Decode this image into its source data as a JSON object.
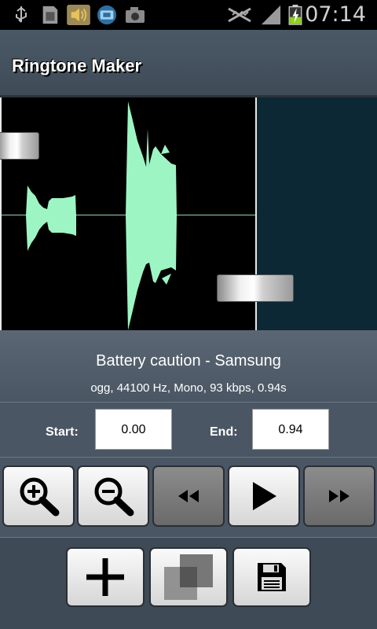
{
  "status_bar": {
    "time": "07:14",
    "icons": [
      "usb-icon",
      "sd-card-icon",
      "volume-icon",
      "chat-icon",
      "camera-icon",
      "mute-icon",
      "signal-icon",
      "battery-icon"
    ]
  },
  "app": {
    "title": "Ringtone Maker"
  },
  "waveform": {
    "selection_start": "0.00",
    "selection_end": "0.94"
  },
  "track": {
    "name": "Battery caution - Samsung",
    "details": "ogg, 44100 Hz, Mono, 93 kbps, 0.94s"
  },
  "times": {
    "start_label": "Start:",
    "start_value": "0.00",
    "end_label": "End:",
    "end_value": "0.94"
  },
  "controls": [
    "zoom-in",
    "zoom-out",
    "rewind",
    "play",
    "fast-forward"
  ],
  "actions": [
    "add",
    "copy",
    "save"
  ],
  "colors": {
    "accent": "#9ef5c4",
    "background": "#3e4a56",
    "after_region": "#0c2834"
  }
}
